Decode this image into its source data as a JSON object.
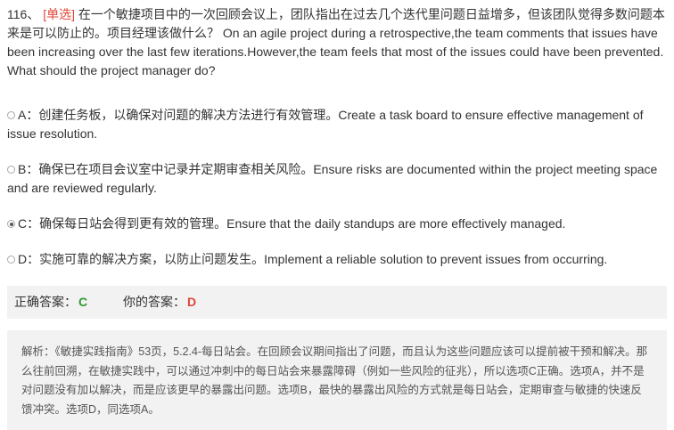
{
  "question": {
    "number": "116、",
    "type": "[单选]",
    "text": "在一个敏捷项目中的一次回顾会议上，团队指出在过去几个迭代里问题日益增多，但该团队觉得多数问题本来是可以防止的。项目经理该做什么？ On an agile project during a retrospective,the team comments that issues have been increasing over the last few iterations.However,the team feels that most of the issues could have been prevented. What should the project manager do?"
  },
  "options": [
    {
      "label": "A：",
      "text": "创建任务板，以确保对问题的解决方法进行有效管理。Create a task board to ensure effective management of issue resolution.",
      "selected": false
    },
    {
      "label": "B：",
      "text": "确保已在项目会议室中记录并定期审查相关风险。Ensure risks are documented within the project meeting space and are reviewed regularly.",
      "selected": false
    },
    {
      "label": "C：",
      "text": "确保每日站会得到更有效的管理。Ensure that the daily standups are more effectively managed.",
      "selected": true
    },
    {
      "label": "D：",
      "text": "实施可靠的解决方案，以防止问题发生。Implement a reliable solution to prevent issues from occurring.",
      "selected": false
    }
  ],
  "answer": {
    "correct_label": "正确答案：",
    "correct_value": "C",
    "your_label": "你的答案：",
    "your_value": "D"
  },
  "explanation": {
    "text": "解析：《敏捷实践指南》53页，5.2.4-每日站会。在回顾会议期间指出了问题，而且认为这些问题应该可以提前被干预和解决。那么往前回溯，在敏捷实践中，可以通过冲刺中的每日站会来暴露障碍（例如一些风险的征兆），所以选项C正确。选项A，并不是对问题没有加以解决，而是应该更早的暴露出问题。选项B，最快的暴露出风险的方式就是每日站会，定期审查与敏捷的快速反馈冲突。选项D，同选项A。"
  },
  "colors": {
    "question_type": "#e0463a",
    "correct_answer": "#2e9a2e",
    "your_answer": "#e0463a",
    "panel_bg": "#f2f2f2"
  }
}
